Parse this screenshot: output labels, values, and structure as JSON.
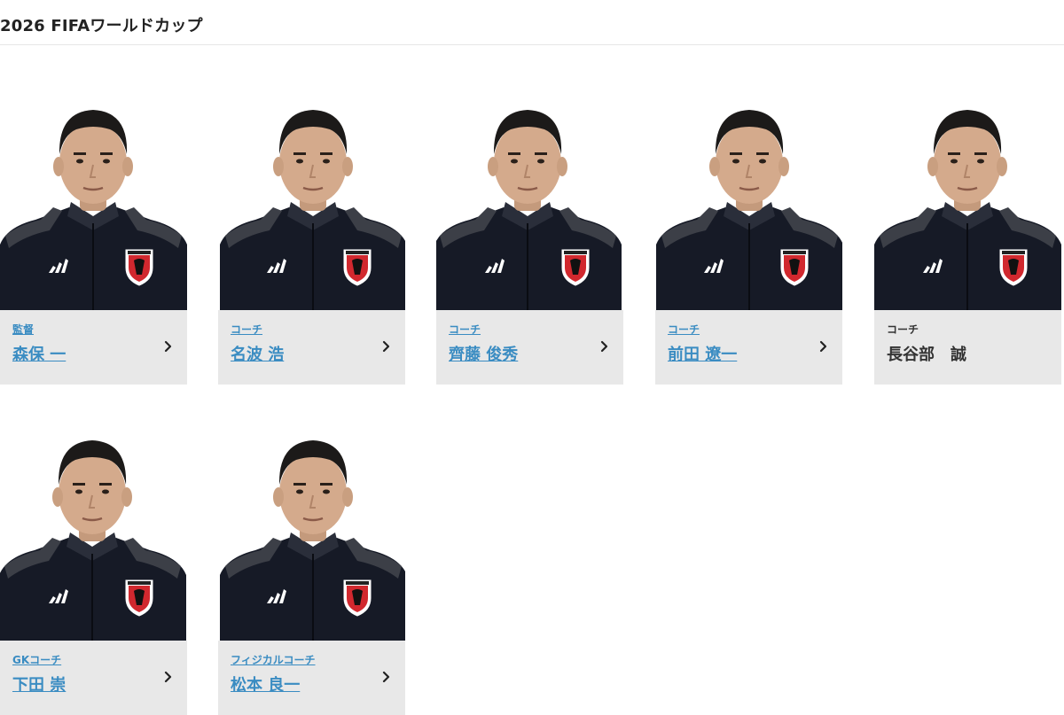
{
  "page": {
    "title": "2026 FIFAワールドカップ"
  },
  "colors": {
    "link": "#3a8cc2",
    "card_bg": "#e8e8e8",
    "jacket": "#161a26",
    "crest_red": "#d1282e"
  },
  "staff": [
    {
      "role": "監督",
      "name": "森保 一",
      "linked": true
    },
    {
      "role": "コーチ",
      "name": "名波 浩",
      "linked": true
    },
    {
      "role": "コーチ",
      "name": "齊藤 俊秀",
      "linked": true
    },
    {
      "role": "コーチ",
      "name": "前田 遼一",
      "linked": true
    },
    {
      "role": "コーチ",
      "name": "長谷部　誠",
      "linked": false
    },
    {
      "role": "GKコーチ",
      "name": "下田 崇",
      "linked": true
    },
    {
      "role": "フィジカルコーチ",
      "name": "松本 良一",
      "linked": true
    }
  ],
  "icons": {
    "chevron": "chevron-right-icon",
    "brand": "adidas-logo-icon",
    "crest": "jfa-crest-icon"
  }
}
